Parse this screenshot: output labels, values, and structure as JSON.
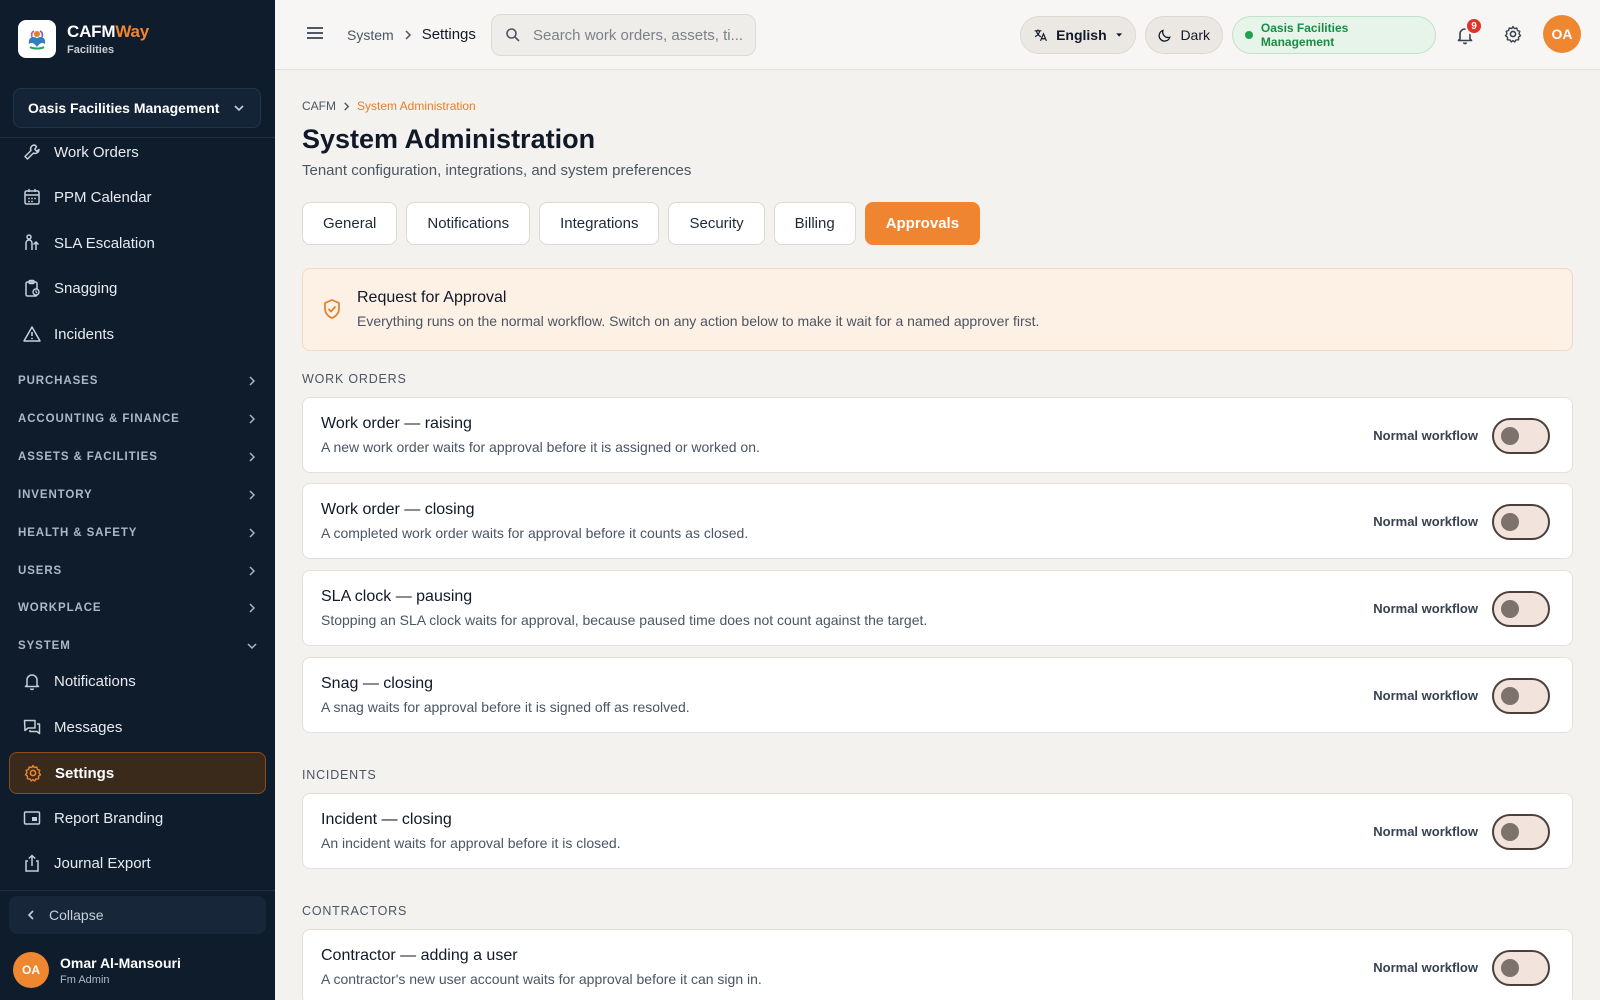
{
  "brand": {
    "name_primary": "CAFM",
    "name_accent": "Way",
    "subtitle": "Facilities"
  },
  "sidebar": {
    "org_selector": "Oasis Facilities Management",
    "items_top": [
      {
        "label": "Work Orders",
        "icon": "wrench-icon"
      },
      {
        "label": "PPM Calendar",
        "icon": "calendar-icon"
      },
      {
        "label": "SLA Escalation",
        "icon": "escalation-icon"
      },
      {
        "label": "Snagging",
        "icon": "clipboard-icon"
      },
      {
        "label": "Incidents",
        "icon": "warning-icon"
      }
    ],
    "groups": [
      "PURCHASES",
      "ACCOUNTING & FINANCE",
      "ASSETS & FACILITIES",
      "INVENTORY",
      "HEALTH & SAFETY",
      "USERS",
      "WORKPLACE",
      "SYSTEM"
    ],
    "items_system": [
      {
        "label": "Notifications",
        "icon": "bell-icon"
      },
      {
        "label": "Messages",
        "icon": "messages-icon"
      },
      {
        "label": "Settings",
        "icon": "gear-icon",
        "active": true
      },
      {
        "label": "Report Branding",
        "icon": "branding-icon"
      },
      {
        "label": "Journal Export",
        "icon": "export-icon"
      }
    ],
    "collapse_label": "Collapse",
    "user": {
      "initials": "OA",
      "name": "Omar Al-Mansouri",
      "role": "Fm Admin"
    }
  },
  "topbar": {
    "breadcrumb": [
      "System",
      "Settings"
    ],
    "search_placeholder": "Search work orders, assets, ti...",
    "language": "English",
    "theme": "Dark",
    "org_status": "Oasis Facilities Management",
    "notification_count": "9",
    "avatar_initials": "OA"
  },
  "page": {
    "breadcrumb": [
      "CAFM",
      "System Administration"
    ],
    "title": "System Administration",
    "subtitle": "Tenant configuration, integrations, and system preferences",
    "tabs": [
      "General",
      "Notifications",
      "Integrations",
      "Security",
      "Billing",
      "Approvals"
    ],
    "active_tab": "Approvals",
    "notice": {
      "title": "Request for Approval",
      "description": "Everything runs on the normal workflow. Switch on any action below to make it wait for a named approver first."
    },
    "sections": [
      {
        "label": "WORK ORDERS",
        "items": [
          {
            "title": "Work order — raising",
            "description": "A new work order waits for approval before it is assigned or worked on.",
            "status": "Normal workflow",
            "enabled": false
          },
          {
            "title": "Work order — closing",
            "description": "A completed work order waits for approval before it counts as closed.",
            "status": "Normal workflow",
            "enabled": false
          },
          {
            "title": "SLA clock — pausing",
            "description": "Stopping an SLA clock waits for approval, because paused time does not count against the target.",
            "status": "Normal workflow",
            "enabled": false
          },
          {
            "title": "Snag — closing",
            "description": "A snag waits for approval before it is signed off as resolved.",
            "status": "Normal workflow",
            "enabled": false
          }
        ]
      },
      {
        "label": "INCIDENTS",
        "items": [
          {
            "title": "Incident — closing",
            "description": "An incident waits for approval before it is closed.",
            "status": "Normal workflow",
            "enabled": false
          }
        ]
      },
      {
        "label": "CONTRACTORS",
        "items": [
          {
            "title": "Contractor — adding a user",
            "description": "A contractor's new user account waits for approval before it can sign in.",
            "status": "Normal workflow",
            "enabled": false
          }
        ]
      }
    ]
  },
  "colors": {
    "accent": "#ef8431",
    "sidebar_bg": "#0f1c2b",
    "status_green": "#1f8a45",
    "badge_red": "#e0322b"
  }
}
